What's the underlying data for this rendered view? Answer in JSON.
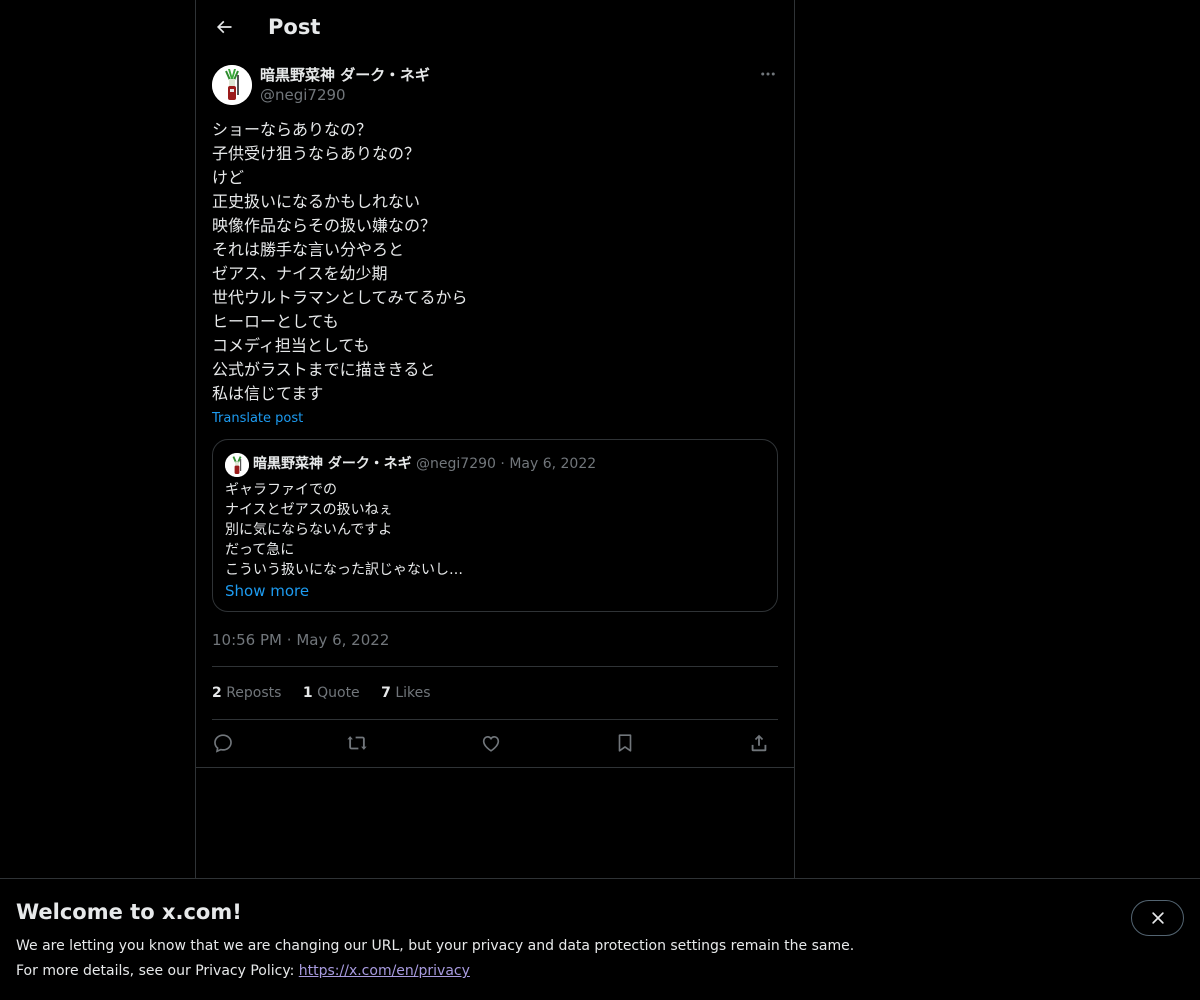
{
  "header": {
    "title": "Post",
    "back_icon": "arrow-left-icon"
  },
  "author": {
    "name": "暗黒野菜神 ダーク・ネギ",
    "handle": "@negi7290",
    "more_icon": "more-horizontal-icon"
  },
  "post": {
    "lines": [
      "ショーならありなの？",
      "子供受け狙うならありなの？",
      "けど",
      "正史扱いになるかもしれない",
      "映像作品ならその扱い嫌なの？",
      "それは勝手な言い分やろと",
      "ゼアス、ナイスを幼少期",
      "世代ウルトラマンとしてみてるから",
      "ヒーローとしても",
      "コメディ担当としても",
      "公式がラストまでに描ききると",
      "私は信じてます"
    ],
    "translate_label": "Translate post",
    "time": "10:56 PM",
    "dot": "·",
    "date": "May 6, 2022"
  },
  "quote": {
    "name": "暗黒野菜神 ダーク・ネギ",
    "handle": "@negi7290",
    "dot": "·",
    "date": "May 6, 2022",
    "lines": [
      "ギャラファイでの",
      "ナイスとゼアスの扱いねぇ",
      "別に気にならないんですよ",
      "だって急に",
      "こういう扱いになった訳じゃないし…"
    ],
    "show_more": "Show more"
  },
  "stats": {
    "reposts_count": "2",
    "reposts_label": "Reposts",
    "quotes_count": "1",
    "quotes_label": "Quote",
    "likes_count": "7",
    "likes_label": "Likes"
  },
  "actions": [
    {
      "name": "reply-icon"
    },
    {
      "name": "repost-icon"
    },
    {
      "name": "like-icon"
    },
    {
      "name": "bookmark-icon"
    },
    {
      "name": "share-icon"
    }
  ],
  "banner": {
    "title": "Welcome to x.com!",
    "line1": "We are letting you know that we are changing our URL, but your privacy and data protection settings remain the same.",
    "line2_prefix": "For more details, see our Privacy Policy: ",
    "link": "https://x.com/en/privacy",
    "close_icon": "close-icon"
  },
  "colors": {
    "background": "#000000",
    "text": "#e7e9ea",
    "secondary": "#71767b",
    "accent": "#1d9bf0",
    "border": "#2f3336"
  }
}
